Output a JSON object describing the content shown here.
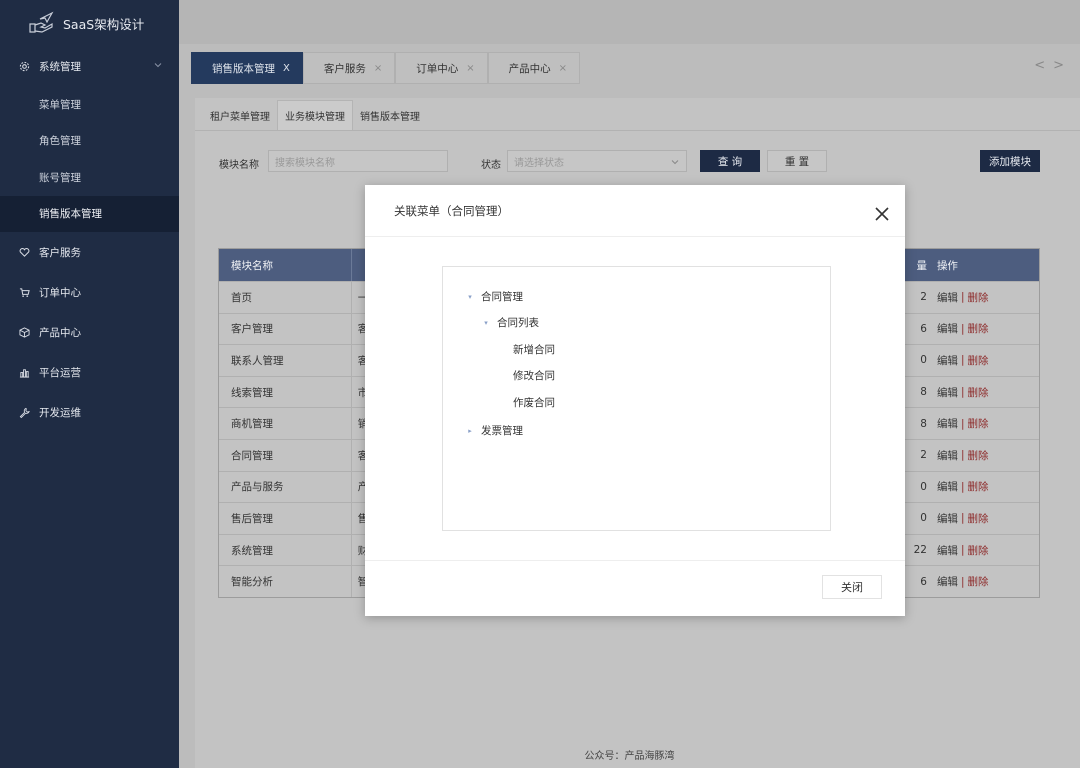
{
  "app": {
    "title": "SaaS架构设计"
  },
  "sidebar": {
    "groups": [
      {
        "label": "系统管理",
        "icon": "gear-icon"
      },
      {
        "label": "客户服务",
        "icon": "heart-icon"
      },
      {
        "label": "订单中心",
        "icon": "cart-icon"
      },
      {
        "label": "产品中心",
        "icon": "cube-icon"
      },
      {
        "label": "平台运营",
        "icon": "bar-chart-icon"
      },
      {
        "label": "开发运维",
        "icon": "wrench-icon"
      }
    ],
    "subitems": [
      {
        "label": "菜单管理"
      },
      {
        "label": "角色管理"
      },
      {
        "label": "账号管理"
      },
      {
        "label": "销售版本管理",
        "active": true
      }
    ]
  },
  "tabs": [
    {
      "label": "销售版本管理",
      "close": "X"
    },
    {
      "label": "客户服务",
      "close": "×"
    },
    {
      "label": "订单中心",
      "close": "×"
    },
    {
      "label": "产品中心",
      "close": "×"
    }
  ],
  "tab_nav": {
    "prev": "<",
    "next": ">"
  },
  "subtabs": [
    {
      "label": "租户菜单管理"
    },
    {
      "label": "业务模块管理"
    },
    {
      "label": "销售版本管理"
    }
  ],
  "filters": {
    "module_label": "模块名称",
    "module_placeholder": "搜索模块名称",
    "status_label": "状态",
    "status_placeholder": "请选择状态",
    "query_button": "查 询",
    "reset_button": "重 置",
    "add_button": "添加模块"
  },
  "table": {
    "headers": {
      "name": "模块名称",
      "count_tail": "量",
      "ops": "操作"
    },
    "rows": [
      {
        "name": "首页",
        "mid": "一",
        "num": "2"
      },
      {
        "name": "客户管理",
        "mid": "客",
        "num": "6"
      },
      {
        "name": "联系人管理",
        "mid": "客",
        "num": "0"
      },
      {
        "name": "线索管理",
        "mid": "市",
        "num": "8"
      },
      {
        "name": "商机管理",
        "mid": "销",
        "num": "8"
      },
      {
        "name": "合同管理",
        "mid": "客",
        "num": "2"
      },
      {
        "name": "产品与服务",
        "mid": "产",
        "num": "0"
      },
      {
        "name": "售后管理",
        "mid": "售",
        "num": "0"
      },
      {
        "name": "系统管理",
        "mid": "财",
        "num": "22"
      },
      {
        "name": "智能分析",
        "mid": "智",
        "num": "6"
      }
    ],
    "op_edit": "编辑",
    "op_sep": "|",
    "op_delete": "删除"
  },
  "footer": {
    "text": "公众号：产品海豚湾"
  },
  "modal": {
    "title": "关联菜单（合同管理）",
    "tree": [
      {
        "label": "合同管理",
        "caret": "▾"
      },
      {
        "label": "合同列表",
        "caret": "▾"
      },
      {
        "label": "新增合同"
      },
      {
        "label": "修改合同"
      },
      {
        "label": "作废合同"
      },
      {
        "label": "发票管理",
        "caret": "▸"
      }
    ],
    "close_button": "关闭"
  }
}
